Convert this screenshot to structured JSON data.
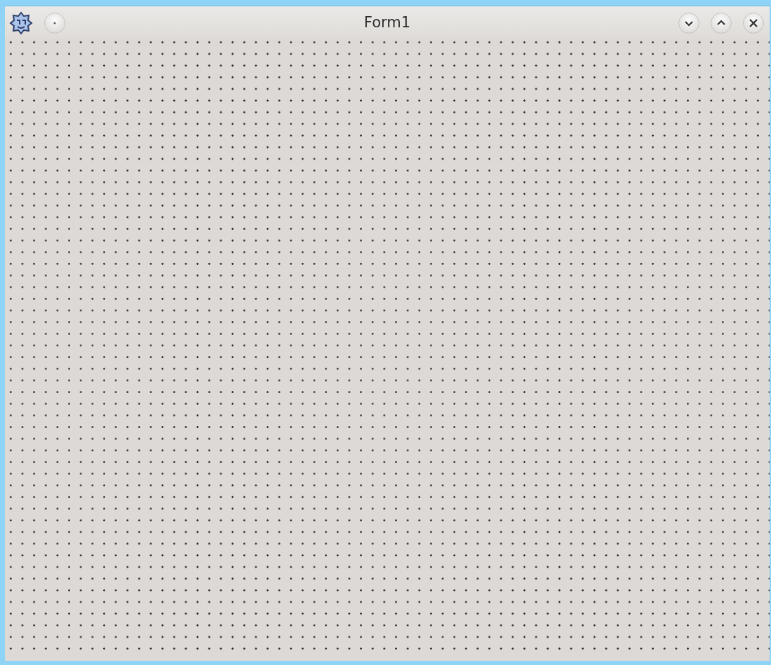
{
  "window": {
    "title": "Form1"
  }
}
